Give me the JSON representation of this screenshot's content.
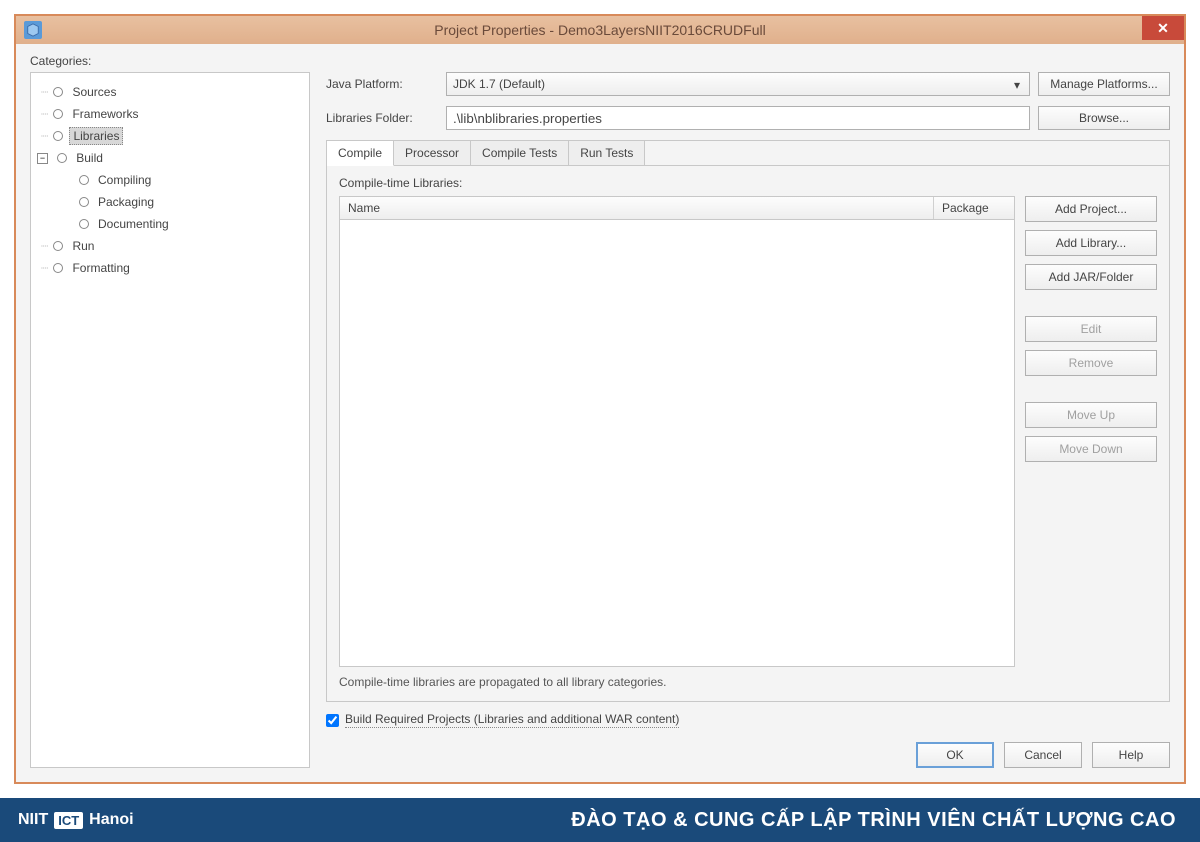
{
  "window": {
    "title": "Project Properties - Demo3LayersNIIT2016CRUDFull"
  },
  "categories_label": "Categories:",
  "tree": {
    "items": [
      {
        "label": "Sources",
        "indent": 0
      },
      {
        "label": "Frameworks",
        "indent": 0
      },
      {
        "label": "Libraries",
        "indent": 0,
        "selected": true
      },
      {
        "label": "Build",
        "indent": 0,
        "expandable": true
      },
      {
        "label": "Compiling",
        "indent": 1
      },
      {
        "label": "Packaging",
        "indent": 1
      },
      {
        "label": "Documenting",
        "indent": 1
      },
      {
        "label": "Run",
        "indent": 0
      },
      {
        "label": "Formatting",
        "indent": 0
      }
    ]
  },
  "form": {
    "platform_label": "Java Platform:",
    "platform_value": "JDK 1.7 (Default)",
    "manage_btn": "Manage Platforms...",
    "folder_label": "Libraries Folder:",
    "folder_value": ".\\lib\\nblibraries.properties",
    "browse_btn": "Browse..."
  },
  "tabs": [
    "Compile",
    "Processor",
    "Compile Tests",
    "Run Tests"
  ],
  "active_tab": 0,
  "section_label": "Compile-time Libraries:",
  "table_headers": {
    "name": "Name",
    "package": "Package"
  },
  "buttons": {
    "add_project": "Add Project...",
    "add_library": "Add Library...",
    "add_jar": "Add JAR/Folder",
    "edit": "Edit",
    "remove": "Remove",
    "move_up": "Move Up",
    "move_down": "Move Down"
  },
  "hint": "Compile-time libraries are propagated to all library categories.",
  "checkbox_label": "Build Required Projects (Libraries and additional WAR content)",
  "footer_btns": {
    "ok": "OK",
    "cancel": "Cancel",
    "help": "Help"
  },
  "page_footer": {
    "logo_prefix": "NIIT",
    "logo_box": "ICT",
    "logo_suffix": "Hanoi",
    "tagline": "ĐÀO TẠO & CUNG CẤP LẬP TRÌNH VIÊN CHẤT LƯỢNG CAO"
  }
}
